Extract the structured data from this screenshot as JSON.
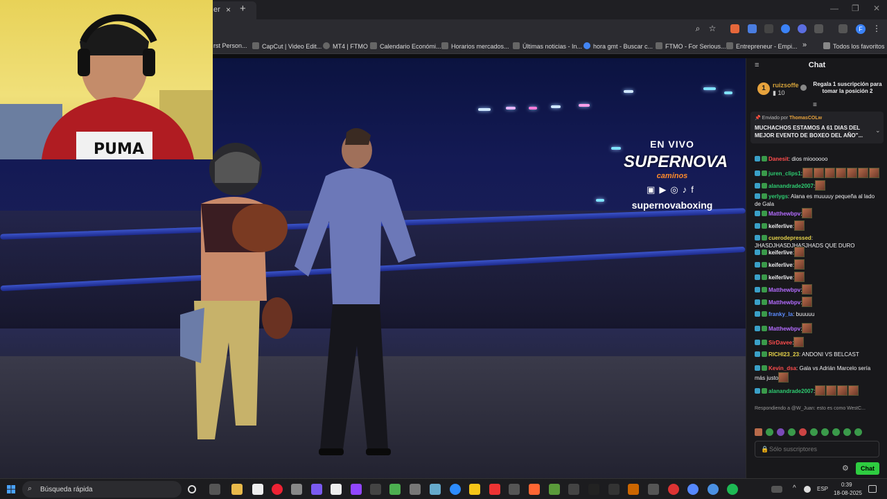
{
  "browser": {
    "tab_title": "er",
    "tab_close": "×",
    "new_tab": "+",
    "win_min": "—",
    "win_restore": "❐",
    "win_close": "✕",
    "profile_initial": "F",
    "bookmarks": [
      "rst Person...",
      "CapCut | Video Edit...",
      "MT4 | FTMO",
      "Calendario Económi...",
      "Horarios mercados...",
      "Últimas noticias - In...",
      "hora gmt - Buscar c...",
      "FTMO - For Serious...",
      "Entrepreneur - Empi..."
    ],
    "bookmarks_more": "»",
    "all_favorites": "Todos los favoritos"
  },
  "stream_overlay": {
    "live_label": "EN VIVO",
    "brand": "SUPERNOVA",
    "sub_brand": "caminos",
    "handle": "supernovaboxing",
    "social_icons": [
      "twitch-icon",
      "youtube-icon",
      "instagram-icon",
      "tiktok-icon",
      "facebook-icon"
    ]
  },
  "chat": {
    "title": "Chat",
    "menu_icon": "≡",
    "top_sub": {
      "rank": "1",
      "user": "ruizsoffe",
      "count": "10",
      "offer": "Regala 1 suscripción para tomar la posición 2"
    },
    "pinned": {
      "sent_by_label": "Enviado por",
      "user": "ThomasCOLw",
      "message": "MUCHACHOS ESTAMOS A 61 DIAS DEL MEJOR EVENTO DE BOXEO DEL AÑO\"..."
    },
    "messages": [
      {
        "user": "Danesit",
        "color": "#ff4d4d",
        "text": ": dios mioooooo",
        "emotes": 0
      },
      {
        "user": "juren_clips1",
        "color": "#2ecc71",
        "text": ":",
        "emotes": 7
      },
      {
        "user": "alanandrade2007",
        "color": "#2ecc71",
        "text": ":",
        "emotes": 1
      },
      {
        "user": "yerlygs",
        "color": "#2ecc71",
        "text": ": Alana es muuuuy pequeña al lado de Gala",
        "emotes": 0
      },
      {
        "user": "Matthewbpv",
        "color": "#b46cff",
        "text": ":",
        "emotes": 1
      },
      {
        "user": "keiferlive",
        "color": "#efeff1",
        "text": ":",
        "emotes": 1
      },
      {
        "user": "cuerodepressed",
        "color": "#e6d34a",
        "text": ": JHASDJHASDJHASJHADS QUE DURO",
        "emotes": 0
      },
      {
        "user": "keiferlive",
        "color": "#efeff1",
        "text": ":",
        "emotes": 1
      },
      {
        "user": "keiferlive",
        "color": "#efeff1",
        "text": ":",
        "emotes": 1
      },
      {
        "user": "keiferlive",
        "color": "#efeff1",
        "text": ":",
        "emotes": 1
      },
      {
        "user": "Matthewbpv",
        "color": "#b46cff",
        "text": ":",
        "emotes": 1
      },
      {
        "user": "Matthewbpv",
        "color": "#b46cff",
        "text": ":",
        "emotes": 1
      },
      {
        "user": "franky_la",
        "color": "#5b8cff",
        "text": ": buuuuu",
        "emotes": 0
      },
      {
        "user": "Matthewbpv",
        "color": "#b46cff",
        "text": ":",
        "emotes": 1
      },
      {
        "user": "SirDavee",
        "color": "#ff4d4d",
        "text": ":",
        "emotes": 1
      },
      {
        "user": "RICHI23_23",
        "color": "#e6d34a",
        "text": ": ANDONI VS BELCAST",
        "emotes": 0
      },
      {
        "user": "Kevin_dsa",
        "color": "#ff4d4d",
        "text": ": Gala vs Adrián Marcelo sería más justo",
        "emotes": 1
      },
      {
        "user": "alanandrade2007",
        "color": "#2ecc71",
        "text": ":",
        "emotes": 4
      }
    ],
    "reply_hint": "Respondiendo a @W_Juan: esto es como WestC...",
    "input_placeholder": "Sólo suscriptores",
    "chat_button": "Chat"
  },
  "taskbar": {
    "search_placeholder": "Búsqueda rápida",
    "lang": "ESP",
    "time": "0:39",
    "date": "18-08-2025"
  }
}
